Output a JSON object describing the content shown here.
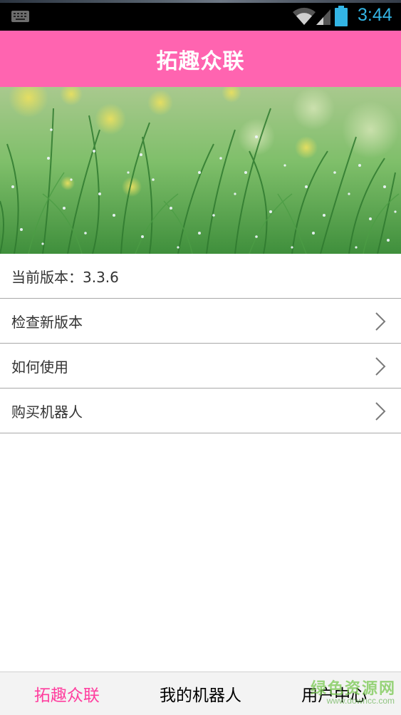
{
  "status_bar": {
    "time": "3:44",
    "icons": [
      "keyboard-icon",
      "wifi-icon",
      "signal-icon",
      "battery-icon"
    ],
    "time_color": "#33b5e5"
  },
  "header": {
    "title": "拓趣众联",
    "background_color": "#ff64b0"
  },
  "banner": {
    "description_icon": "grass-photo"
  },
  "settings": {
    "version_label": "当前版本：3.3.6",
    "items": [
      {
        "label": "检查新版本",
        "icon": "chevron-right-icon"
      },
      {
        "label": "如何使用",
        "icon": "chevron-right-icon"
      },
      {
        "label": "购买机器人",
        "icon": "chevron-right-icon"
      }
    ]
  },
  "bottom_nav": {
    "tabs": [
      {
        "label": "拓趣众联",
        "active": true
      },
      {
        "label": "我的机器人",
        "active": false
      },
      {
        "label": "用户中心",
        "active": false
      }
    ],
    "active_color": "#ff3d9e"
  },
  "watermark": {
    "main": "绿色资源网",
    "sub": "www.downcc.com"
  }
}
